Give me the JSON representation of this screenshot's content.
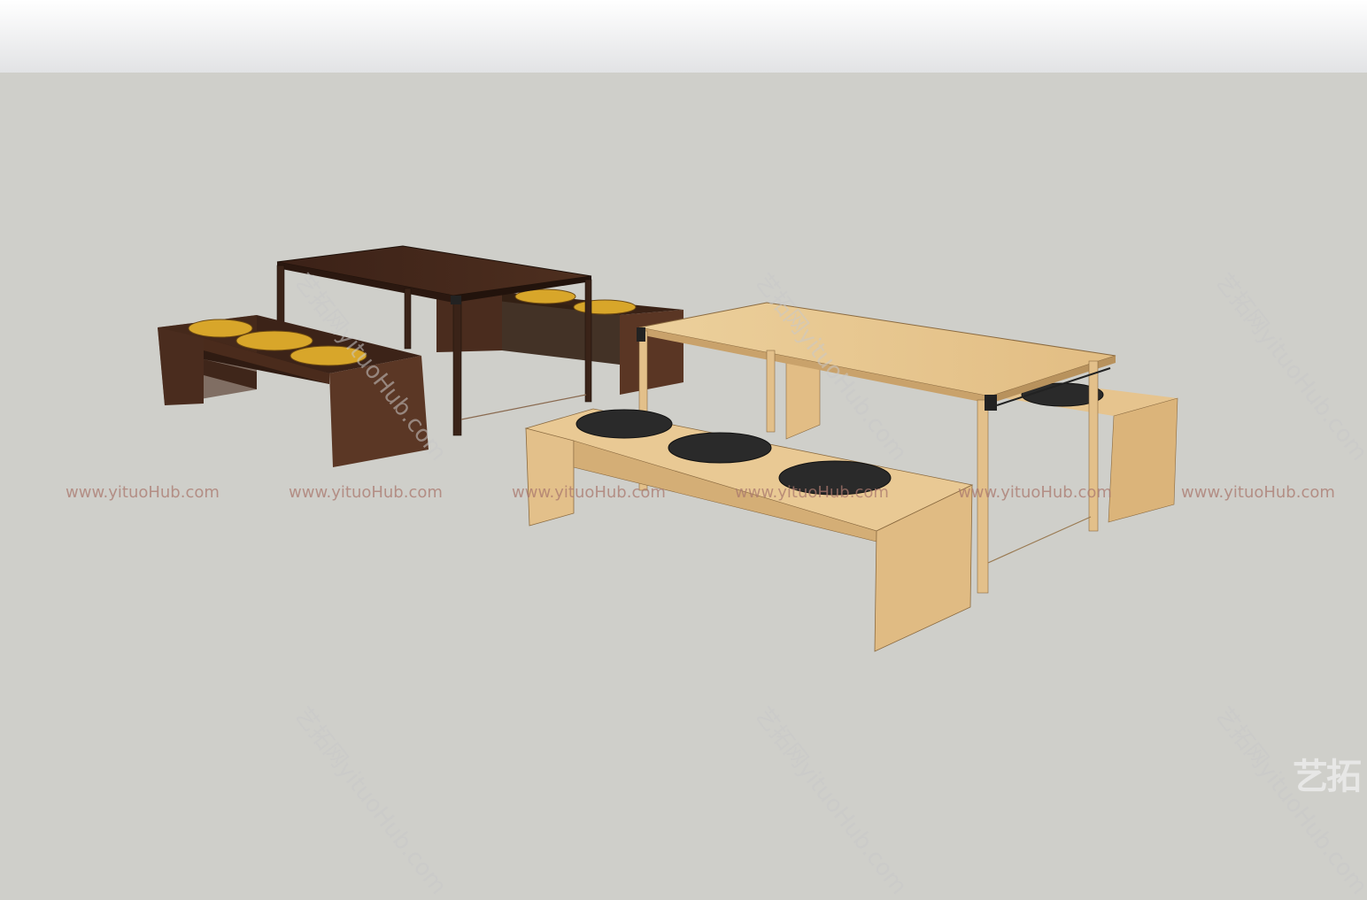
{
  "scene": {
    "description_colors": {
      "dark_wood": "#3e2418",
      "dark_wood_side": "#4a2c1e",
      "light_wood": "#e7c58e",
      "light_wood_side": "#d8b47c",
      "yellow_cushion": "#d8a62a",
      "black_cushion": "#2a2a2a",
      "sky_top": "#ffffff",
      "ground": "#cfcfca"
    }
  },
  "watermarks": {
    "row": [
      "www.yituoHub.com",
      "www.yituoHub.com",
      "www.yituoHub.com",
      "www.yituoHub.com",
      "www.yituoHub.com",
      "www.yituoHub.com"
    ],
    "diagonal": [
      "艺拓网yituoHub.com",
      "艺拓网yituoHub.com",
      "艺拓网yituoHub.com",
      "艺拓网yituoHub.com",
      "艺拓网yituoHub.com",
      "艺拓网yituoHub.com"
    ],
    "logo": "艺拓"
  }
}
